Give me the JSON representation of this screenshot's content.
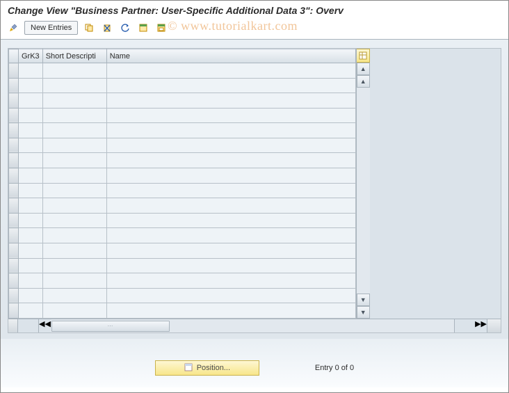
{
  "title": "Change View \"Business Partner: User-Specific Additional Data 3\": Overv",
  "watermark": "© www.tutorialkart.com",
  "toolbar": {
    "new_entries_label": "New Entries"
  },
  "grid": {
    "columns": {
      "grk3": "GrK3",
      "short_desc": "Short Descripti",
      "name": "Name"
    },
    "row_count": 17
  },
  "footer": {
    "position_label": "Position...",
    "entry_text": "Entry 0 of 0"
  }
}
